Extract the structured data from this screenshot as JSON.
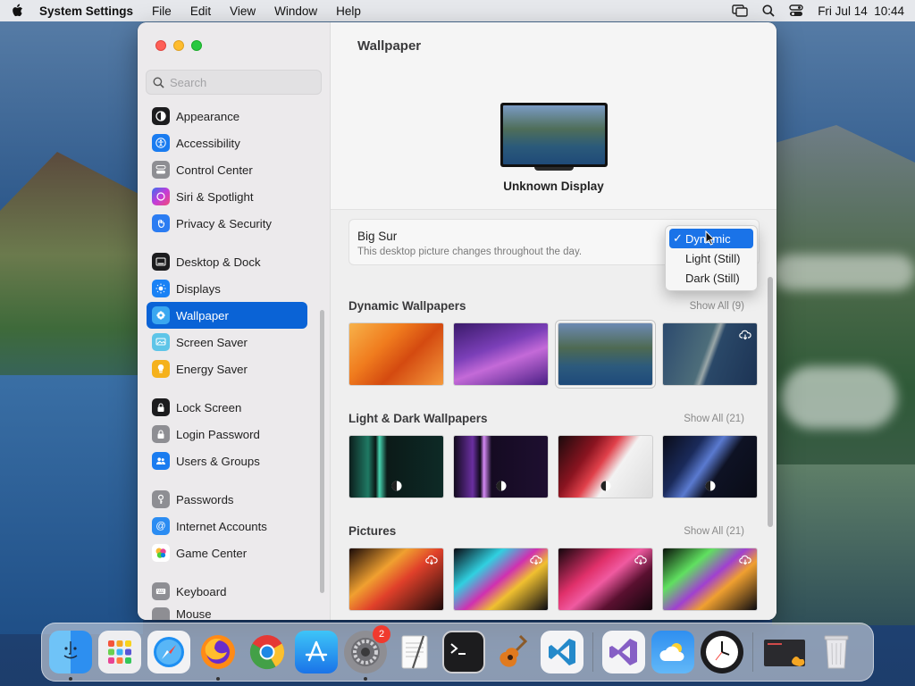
{
  "menubar": {
    "app_name": "System Settings",
    "items": [
      "File",
      "Edit",
      "View",
      "Window",
      "Help"
    ],
    "datetime": "Fri Jul 14  10:44"
  },
  "sidebar": {
    "search_placeholder": "Search",
    "items": [
      {
        "label": "Appearance",
        "icon": "appearance-icon",
        "color": "#1c1c1e"
      },
      {
        "label": "Accessibility",
        "icon": "accessibility-icon",
        "color": "#1a7cf0"
      },
      {
        "label": "Control Center",
        "icon": "control-center-icon",
        "color": "#8e8e93"
      },
      {
        "label": "Siri & Spotlight",
        "icon": "siri-icon",
        "color": "#c33cd8"
      },
      {
        "label": "Privacy & Security",
        "icon": "hand-icon",
        "color": "#2b7cf2"
      },
      {
        "label": "Desktop & Dock",
        "icon": "dock-icon",
        "color": "#1c1c1e"
      },
      {
        "label": "Displays",
        "icon": "sun-icon",
        "color": "#1a82f5"
      },
      {
        "label": "Wallpaper",
        "icon": "wallpaper-icon",
        "color": "#3aa7f0"
      },
      {
        "label": "Screen Saver",
        "icon": "screen-saver-icon",
        "color": "#5ec5e8"
      },
      {
        "label": "Energy Saver",
        "icon": "battery-icon",
        "color": "#f5b11b"
      },
      {
        "label": "Lock Screen",
        "icon": "lock-icon",
        "color": "#1c1c1e"
      },
      {
        "label": "Login Password",
        "icon": "login-lock-icon",
        "color": "#8e8e93"
      },
      {
        "label": "Users & Groups",
        "icon": "users-icon",
        "color": "#1a7cf0"
      },
      {
        "label": "Passwords",
        "icon": "key-icon",
        "color": "#8e8e93"
      },
      {
        "label": "Internet Accounts",
        "icon": "at-icon",
        "color": "#2b8cf2"
      },
      {
        "label": "Game Center",
        "icon": "game-center-icon",
        "color": "#ffffff"
      },
      {
        "label": "Keyboard",
        "icon": "keyboard-icon",
        "color": "#8e8e93"
      },
      {
        "label": "Mouse",
        "icon": "mouse-icon",
        "color": "#8e8e93"
      }
    ],
    "active_index": 7
  },
  "content": {
    "title": "Wallpaper",
    "display_name": "Unknown Display",
    "current": {
      "name": "Big Sur",
      "description": "This desktop picture changes throughout the day."
    },
    "dropdown": {
      "options": [
        "Dynamic",
        "Light (Still)",
        "Dark (Still)"
      ],
      "selected": "Dynamic",
      "check": "✓"
    },
    "sections": [
      {
        "title": "Dynamic Wallpapers",
        "show_all": "Show All (9)"
      },
      {
        "title": "Light & Dark Wallpapers",
        "show_all": "Show All (21)"
      },
      {
        "title": "Pictures",
        "show_all": "Show All (21)"
      }
    ]
  },
  "dock": {
    "apps": [
      "Finder",
      "Launchpad",
      "Safari",
      "Firefox",
      "Chrome",
      "App Store",
      "System Settings",
      "TextEdit",
      "Terminal",
      "GarageBand",
      "VS Code",
      "Visual Studio",
      "Weather",
      "Clock",
      "Screen Recorder",
      "Trash"
    ],
    "settings_badge": "2"
  }
}
